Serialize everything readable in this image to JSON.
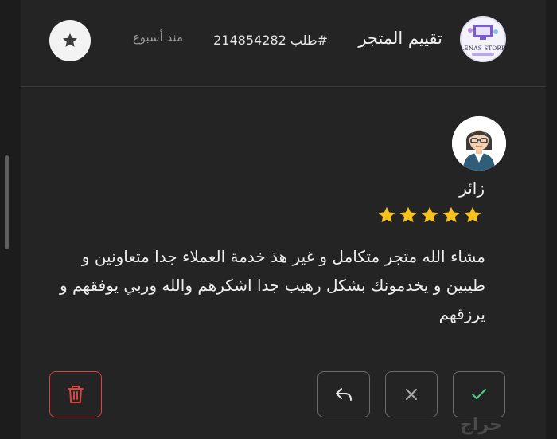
{
  "header": {
    "store_title": "تقييم المتجر",
    "order_label": "طلب 214854282#",
    "time_ago": "منذ أسبوع",
    "store_logo_text": "LENAS STORE",
    "star_badge_icon": "star-icon"
  },
  "review": {
    "reviewer_name": "زائر",
    "rating": 5,
    "rating_max": 5,
    "star_color": "#f7c21b",
    "text": "مشاء الله متجر متكامل و غير هذ خدمة العملاء جدا متعاونين و طيبين و يخدمونك بشكل رهيب جدا اشكرهم والله وربي يوفقهم و يرزقهم"
  },
  "actions": {
    "delete_icon": "trash-icon",
    "delete_color": "#d9453f",
    "reply_icon": "reply-arrow-icon",
    "reject_icon": "close-icon",
    "approve_icon": "check-icon",
    "approve_color": "#4fd08a"
  },
  "watermark": {
    "text": "حراج"
  }
}
